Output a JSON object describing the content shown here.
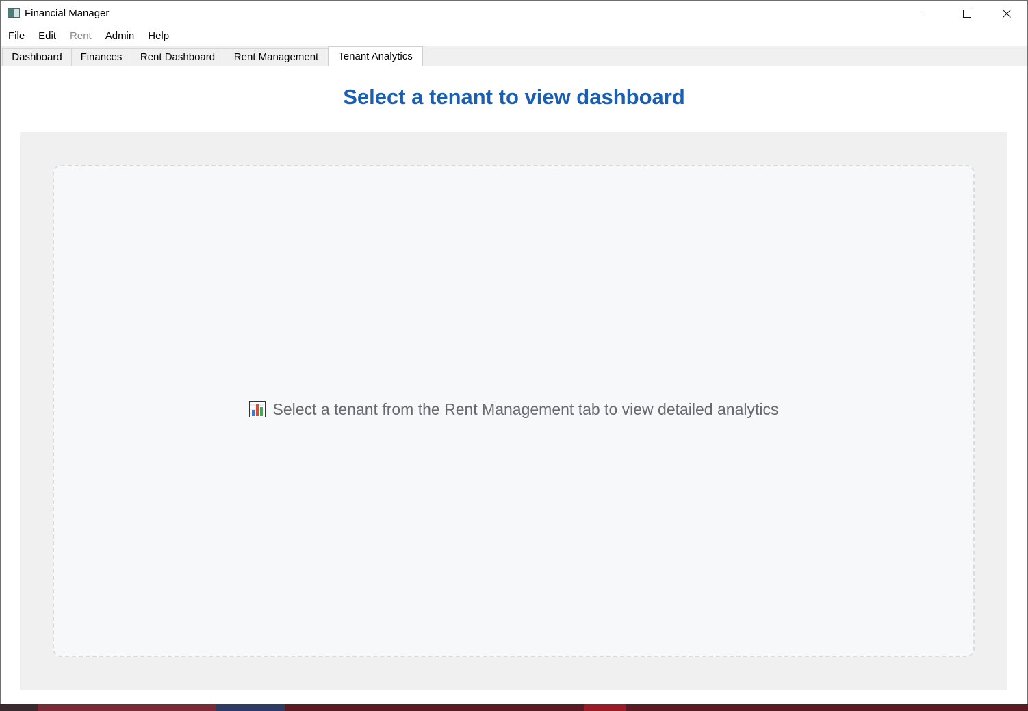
{
  "window": {
    "title": "Financial Manager",
    "app_icon": "app-window-icon",
    "controls": {
      "minimize_icon": "minimize-icon",
      "maximize_icon": "maximize-icon",
      "close_icon": "close-icon"
    }
  },
  "menu": {
    "items": [
      {
        "label": "File",
        "enabled": true
      },
      {
        "label": "Edit",
        "enabled": true
      },
      {
        "label": "Rent",
        "enabled": false
      },
      {
        "label": "Admin",
        "enabled": true
      },
      {
        "label": "Help",
        "enabled": true
      }
    ]
  },
  "tabs": {
    "items": [
      {
        "label": "Dashboard",
        "active": false
      },
      {
        "label": "Finances",
        "active": false
      },
      {
        "label": "Rent Dashboard",
        "active": false
      },
      {
        "label": "Rent Management",
        "active": false
      },
      {
        "label": "Tenant Analytics",
        "active": true
      }
    ]
  },
  "main": {
    "heading": "Select a tenant to view dashboard",
    "placeholder": {
      "icon": "bar-chart-icon",
      "message": "Select a tenant from the Rent Management tab to view detailed analytics"
    }
  },
  "colors": {
    "heading": "#1a5fb4",
    "panel_background": "#f0f0f0",
    "card_background": "#f7f8fa",
    "card_border": "#d9dcdf",
    "message_text": "#666a70"
  }
}
